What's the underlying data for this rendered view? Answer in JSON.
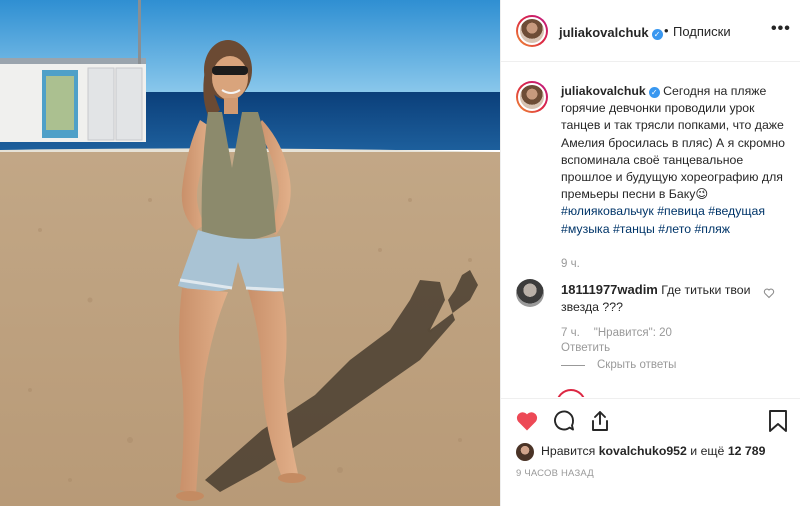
{
  "header": {
    "username": "juliakovalchuk",
    "separator": "•",
    "follow_label": "Подписки",
    "more_label": "•••"
  },
  "caption": {
    "username": "juliakovalchuk",
    "text": "Сегодня на пляже горячие девчонки проводили урок танцев и так трясли попками, что даже Амелия бросилась в пляс) А я скромно вспоминала своё танцевальное прошлое и будущую хореографию для премьеры песни в Баку",
    "emoji": "😉",
    "hashtags": [
      "#юлияковальчук",
      "#певица",
      "#ведущая",
      "#музыка",
      "#танцы",
      "#лето",
      "#пляж"
    ],
    "time": "9 ч."
  },
  "comment": {
    "username": "18111977wadim",
    "text": "Где титьки твои звезда ???",
    "time": "7 ч.",
    "likes": "\"Нравится\": 20",
    "reply_label": "Ответить",
    "hide_replies_label": "Скрыть ответы"
  },
  "likes": {
    "prefix": "Нравится",
    "user": "kovalchuko952",
    "middle": "и ещё",
    "count": "12 789"
  },
  "post_time": "9 ЧАСОВ НАЗАД",
  "colors": {
    "like_red": "#ed4956",
    "hashtag": "#003569",
    "meta_gray": "#999999",
    "verified_blue": "#3897f0"
  },
  "icons": {
    "like": "heart-filled-icon",
    "comment": "comment-bubble-icon",
    "share": "share-arrow-icon",
    "save": "bookmark-icon",
    "verified": "verified-badge-icon",
    "comment_like": "heart-outline-icon"
  }
}
